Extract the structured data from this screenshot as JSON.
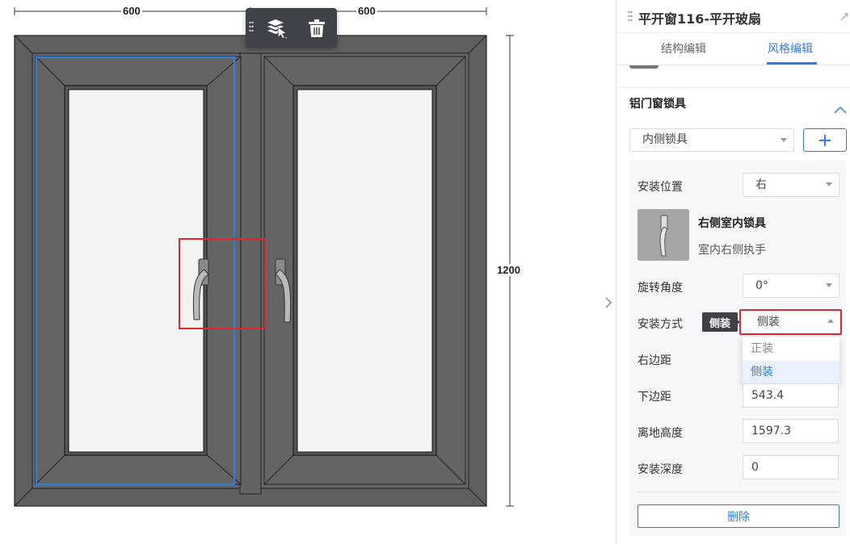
{
  "dimensions": {
    "left_width": "600",
    "right_width": "600",
    "height": "1200"
  },
  "toolbar": {
    "select_icon": "layer-select-icon",
    "delete_icon": "trash-icon"
  },
  "panel": {
    "title": "平开窗116-平开玻扇",
    "tabs": [
      {
        "label": "结构编辑"
      },
      {
        "label": "风格编辑",
        "active": true
      }
    ],
    "section": {
      "title": "铝门窗锁具"
    },
    "lock_type": {
      "value": "内侧锁具",
      "add_icon": "plus-icon"
    },
    "install_position": {
      "label": "安装位置",
      "value": "右"
    },
    "product": {
      "name": "右侧室内锁具",
      "desc": "室内右侧执手"
    },
    "rotation": {
      "label": "旋转角度",
      "value": "0°"
    },
    "install_method": {
      "label": "安装方式",
      "tooltip": "侧装",
      "value": "侧装",
      "options": [
        {
          "label": "正装"
        },
        {
          "label": "侧装",
          "selected": true
        }
      ]
    },
    "right_margin": {
      "label": "右边距"
    },
    "bottom_margin": {
      "label": "下边距",
      "value": "543.4"
    },
    "ground_height": {
      "label": "离地高度",
      "value": "1597.3"
    },
    "install_depth": {
      "label": "安装深度",
      "value": "0"
    },
    "delete_button": {
      "label": "删除"
    }
  },
  "colors": {
    "accent": "#2b7de9",
    "highlight_box": "#e0262e",
    "frame": "#5f5f5f",
    "glass": "#f3f3f3"
  }
}
